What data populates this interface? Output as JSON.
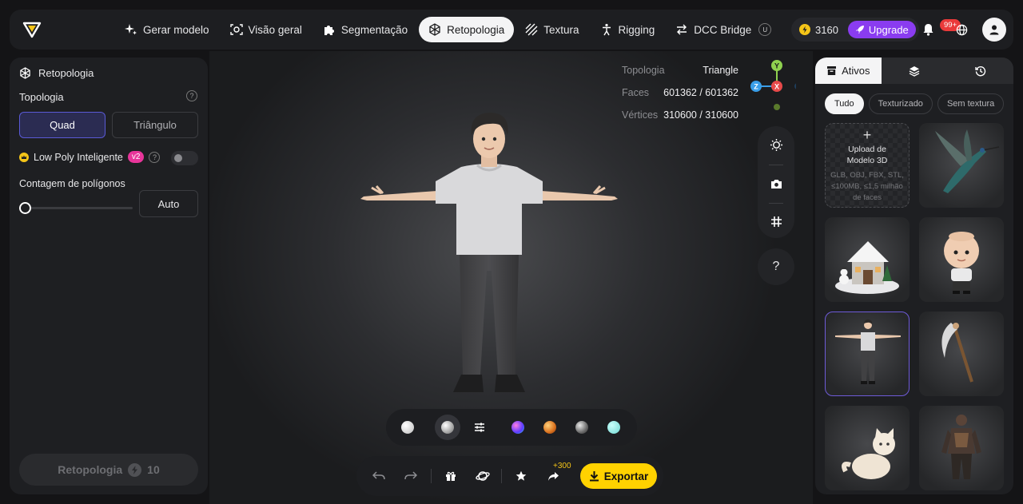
{
  "topbar": {
    "nav": [
      {
        "label": "Gerar modelo",
        "icon": "sparkle-icon"
      },
      {
        "label": "Visão geral",
        "icon": "scan-icon"
      },
      {
        "label": "Segmentação",
        "icon": "puzzle-icon"
      },
      {
        "label": "Retopologia",
        "icon": "retopo-icon",
        "active": true
      },
      {
        "label": "Textura",
        "icon": "texture-icon"
      },
      {
        "label": "Rigging",
        "icon": "rig-person-icon"
      },
      {
        "label": "DCC Bridge",
        "icon": "bridge-icon"
      }
    ],
    "credits": "3160",
    "upgrade_label": "Upgrade",
    "notification_badge": "99+"
  },
  "left_panel": {
    "title": "Retopologia",
    "topology_label": "Topologia",
    "help": "?",
    "quad_label": "Quad",
    "triangle_label": "Triângulo",
    "lowpoly_label": "Low Poly Inteligente",
    "lowpoly_badge": "v2",
    "lowpoly_enabled": false,
    "polycount_label": "Contagem de polígonos",
    "polycount_value": "Auto",
    "run_label": "Retopologia",
    "run_cost": "10"
  },
  "viewport": {
    "stats": [
      {
        "key": "Topologia",
        "value": "Triangle"
      },
      {
        "key": "Faces",
        "value": "601362 / 601362"
      },
      {
        "key": "Vértices",
        "value": "310600 / 310600"
      }
    ],
    "gizmo": {
      "y": "Y",
      "z": "Z",
      "x": "X"
    },
    "help_label": "?",
    "export_bonus": "+300",
    "export_label": "Exportar",
    "materials": [
      "#f0f0f0",
      "#dddddd",
      "#7b5cff",
      "#e08a2a",
      "#9a9a9a",
      "#7fe0dc"
    ]
  },
  "right_panel": {
    "tabs": [
      {
        "label": "Ativos",
        "icon": "box-icon"
      },
      {
        "label": "",
        "icon": "layers-icon"
      },
      {
        "label": "",
        "icon": "history-icon"
      }
    ],
    "filters": [
      "Tudo",
      "Texturizado",
      "Sem textura"
    ],
    "upload_plus": "+",
    "upload_title": "Upload de Modelo 3D",
    "upload_hint": "GLB, OBJ, FBX, STL, ≤100MB, ≤1,5 milhão de faces",
    "assets": [
      "hummingbird",
      "snow-house",
      "baby-character",
      "t-pose-man",
      "scythe",
      "cat",
      "armored-warrior"
    ]
  }
}
